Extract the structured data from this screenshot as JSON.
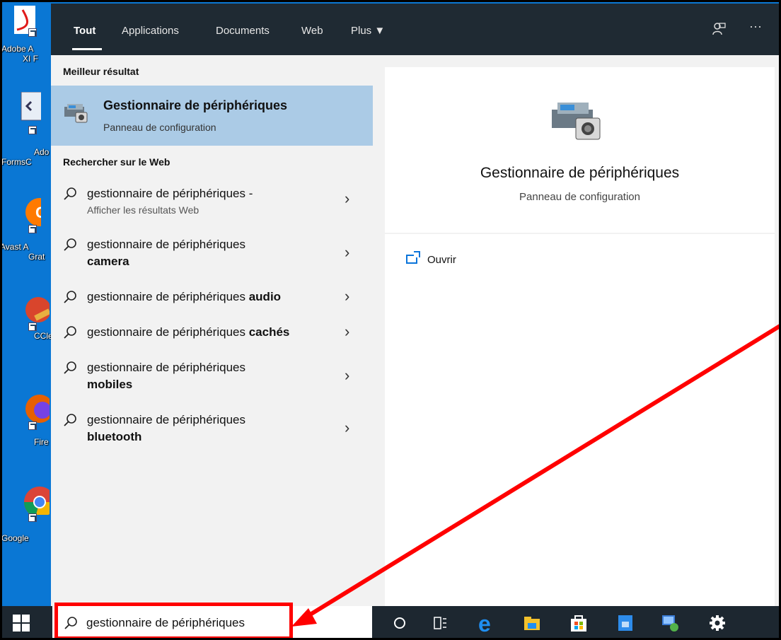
{
  "desktop": {
    "icons": [
      {
        "name": "adobe-reader-shortcut",
        "label_line1": "Adobe A",
        "label_line2": "XI F"
      },
      {
        "name": "adobe-forms-shortcut",
        "label_line1": "Ado",
        "label_line2": "FormsC"
      },
      {
        "name": "avast-shortcut",
        "label_line1": "Avast A",
        "label_line2": "Grat"
      },
      {
        "name": "ccleaner-shortcut",
        "label_line1": "CCle",
        "label_line2": ""
      },
      {
        "name": "firefox-shortcut",
        "label_line1": "Fire",
        "label_line2": ""
      },
      {
        "name": "chrome-shortcut",
        "label_line1": "Google",
        "label_line2": ""
      }
    ]
  },
  "search": {
    "tabs": [
      "Tout",
      "Applications",
      "Documents",
      "Web",
      "Plus ▼"
    ],
    "active_tab": "Tout",
    "feedback_icon": "feedback-icon",
    "more_icon": "more-options-icon",
    "more_glyph": "···",
    "best_match_header": "Meilleur résultat",
    "best_match": {
      "title": "Gestionnaire de périphériques",
      "subtitle": "Panneau de configuration",
      "icon": "device-manager-icon"
    },
    "web_header": "Rechercher sur le Web",
    "web_results": [
      {
        "prefix": "gestionnaire de périphériques -",
        "bold": "",
        "sub": "Afficher les résultats Web"
      },
      {
        "prefix": "gestionnaire de périphériques",
        "bold": "camera",
        "sub": ""
      },
      {
        "prefix": "gestionnaire de périphériques ",
        "bold": "audio",
        "sub": ""
      },
      {
        "prefix": "gestionnaire de périphériques ",
        "bold": "cachés",
        "sub": ""
      },
      {
        "prefix": "gestionnaire de périphériques",
        "bold": "mobiles",
        "sub": ""
      },
      {
        "prefix": "gestionnaire de périphériques",
        "bold": "bluetooth",
        "sub": ""
      }
    ],
    "chevron": "›",
    "preview": {
      "title": "Gestionnaire de périphériques",
      "subtitle": "Panneau de configuration",
      "open_label": "Ouvrir"
    }
  },
  "taskbar": {
    "search_value": "gestionnaire de périphériques",
    "icons": [
      "windows-start-icon",
      "cortana-icon",
      "task-view-icon",
      "edge-icon",
      "file-explorer-icon",
      "store-icon",
      "app-icon",
      "network-app-icon",
      "settings-icon"
    ]
  },
  "annotation": {
    "color": "#ff0000"
  }
}
